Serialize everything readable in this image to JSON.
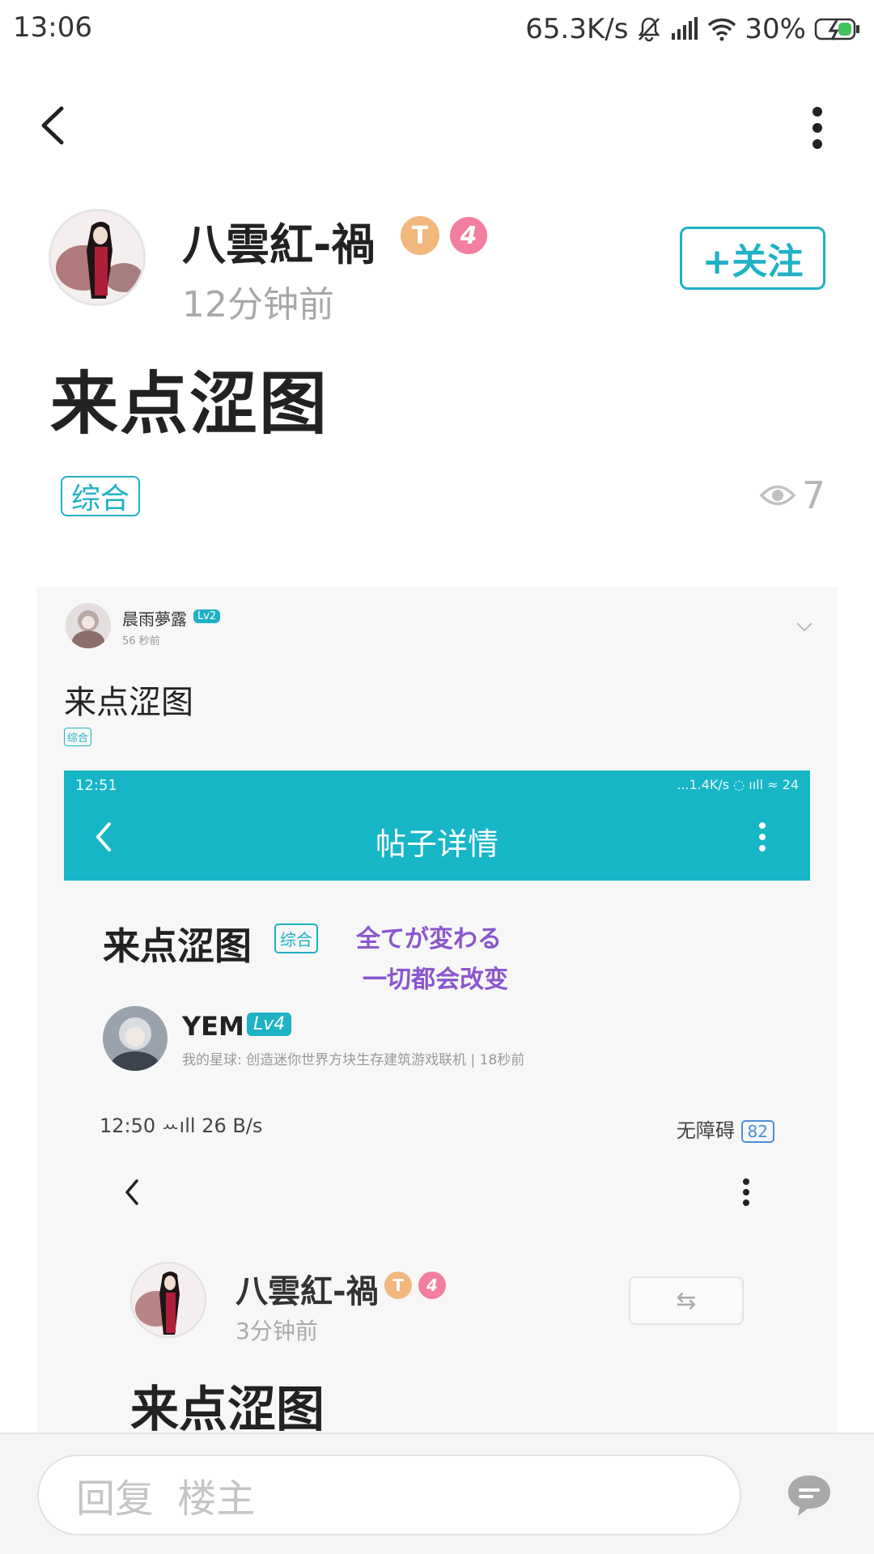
{
  "status_bar": {
    "time": "13:06",
    "speed": "65.3K/s",
    "battery": "30%"
  },
  "post": {
    "author": "八雲紅-禍",
    "badge_ts": "T",
    "level": "4",
    "time": "12分钟前",
    "follow_label": "+关注",
    "title": "来点涩图",
    "tag": "综合",
    "views": "7"
  },
  "embedded": {
    "user1": "晨雨夢露",
    "lv1": "Lv2",
    "time1": "56 秒前",
    "title1": "来点涩图",
    "tag1": "综合",
    "inner_time": "12:51",
    "inner_status": "...1.4K/s",
    "inner_battery": "24",
    "inner_title": "帖子详情",
    "title2": "来点涩图",
    "tag2": "综合",
    "overlay1": "全てが変わる",
    "overlay2": "一切都会改变",
    "user2": "YEM",
    "lv2": "Lv4",
    "sub2": "我的星球: 创造迷你世界方块生存建筑游戏联机 | 18秒前",
    "sb2_left": "12:50 ꕀıll 26 B/s",
    "sb2_right": "无障碍",
    "sb2_battery": "82",
    "author3": "八雲紅-禍",
    "badge3a": "T",
    "badge3b": "4",
    "time3": "3分钟前",
    "btn3": "⇆",
    "title3": "来点涩图"
  },
  "reply": {
    "placeholder": "回复 楼主"
  },
  "colors": {
    "accent": "#1fb1c4",
    "muted": "#a8a8a8",
    "purple": "#8a56cf"
  }
}
